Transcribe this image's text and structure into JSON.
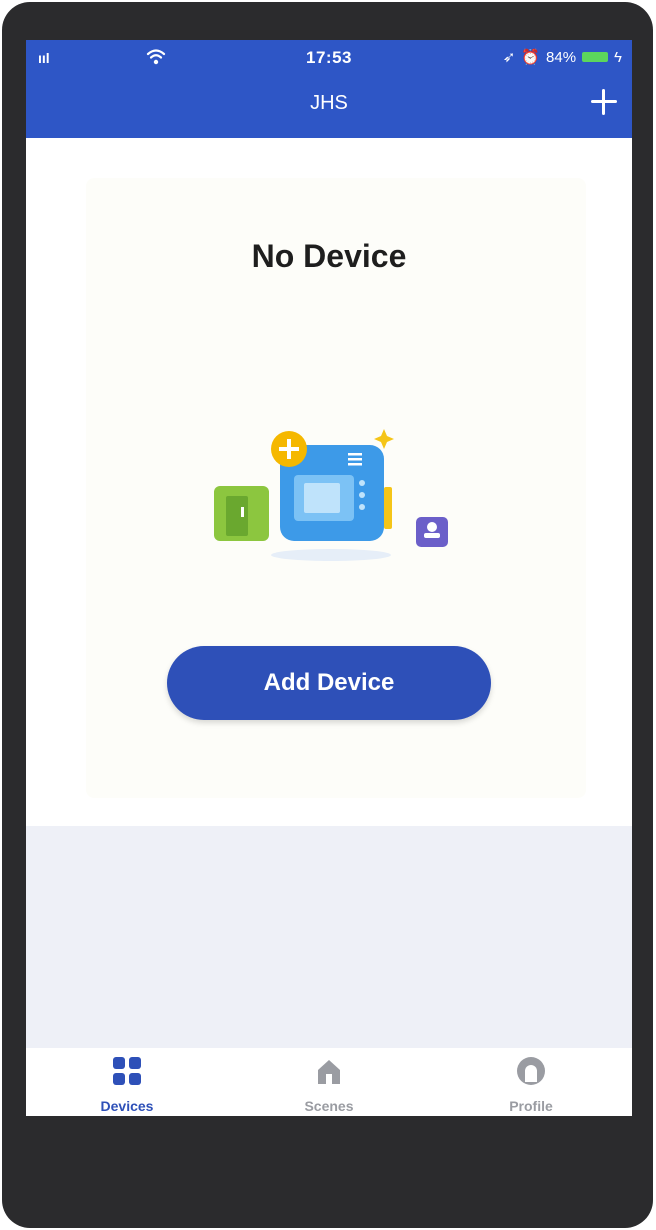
{
  "status_bar": {
    "signal": "ııl",
    "time": "17:53",
    "battery_percent": "84%"
  },
  "header": {
    "title": "JHS",
    "add_icon": "plus-icon"
  },
  "empty_state": {
    "heading": "No Device",
    "button_label": "Add Device"
  },
  "tab_bar": {
    "tabs": [
      {
        "label": "Devices",
        "icon": "grid-icon",
        "active": true
      },
      {
        "label": "Scenes",
        "icon": "home-icon",
        "active": false
      },
      {
        "label": "Profile",
        "icon": "profile-icon",
        "active": false
      }
    ]
  },
  "colors": {
    "header": "#2e56c6",
    "button": "#2e50b8",
    "active_tab": "#2e50b8",
    "inactive_tab": "#9a9ca2"
  }
}
